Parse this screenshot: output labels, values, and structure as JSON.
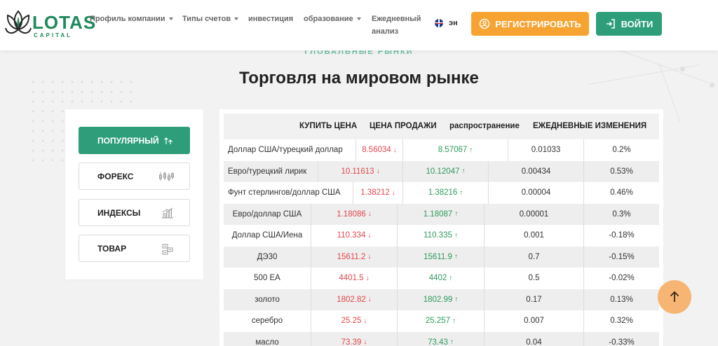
{
  "brand": {
    "name": "LOTAS",
    "sub": "CAPITAL"
  },
  "nav": [
    {
      "label": "Профиль компании",
      "dropdown": true
    },
    {
      "label": "Типы счетов",
      "dropdown": true
    },
    {
      "label": "инвестиция",
      "dropdown": false
    },
    {
      "label": "образование",
      "dropdown": true
    },
    {
      "label": "Ежедневный",
      "line2": "анализ",
      "dropdown": false
    }
  ],
  "language": "эн",
  "buttons": {
    "register": "РЕГИСТРИРОВАТЬ",
    "login": "ВОЙТИ"
  },
  "section": {
    "eyebrow": "ГЛОБАЛЬНЫЕ РЫНКИ",
    "title": "Торговля на мировом рынке"
  },
  "categories": [
    {
      "label": "ПОПУЛЯРНЫЙ",
      "active": true,
      "icon": "arrows-up-icon"
    },
    {
      "label": "ФОРЕКС",
      "active": false,
      "icon": "candles-icon"
    },
    {
      "label": "ИНДЕКСЫ",
      "active": false,
      "icon": "bar-chart-icon"
    },
    {
      "label": "ТОВАР",
      "active": false,
      "icon": "commodity-icon"
    }
  ],
  "table": {
    "headers": [
      "КУПИТЬ ЦЕНА",
      "ЦЕНА ПРОДАЖИ",
      "распространение",
      "ЕЖЕДНЕВНЫЕ ИЗМЕНЕНИЯ"
    ],
    "rows": [
      {
        "name": "Доллар США/турецкий доллар",
        "buy": "8.56034",
        "sell": "8.57067",
        "spread": "0.01033",
        "change": "0.2%"
      },
      {
        "name": "Евро/турецкий лирик",
        "buy": "10.11613",
        "sell": "10.12047",
        "spread": "0.00434",
        "change": "0.53%"
      },
      {
        "name": "Фунт стерлингов/доллар США",
        "buy": "1.38212",
        "sell": "1.38216",
        "spread": "0.00004",
        "change": "0.46%"
      },
      {
        "name": "Евро/доллар США",
        "buy": "1.18086",
        "sell": "1.18087",
        "spread": "0.00001",
        "change": "0.3%"
      },
      {
        "name": "Доллар США/Иена",
        "buy": "110.334",
        "sell": "110.335",
        "spread": "0.001",
        "change": "-0.18%"
      },
      {
        "name": "ДЭ30",
        "buy": "15611.2",
        "sell": "15611.9",
        "spread": "0.7",
        "change": "-0.15%"
      },
      {
        "name": "500 ЕА",
        "buy": "4401.5",
        "sell": "4402",
        "spread": "0.5",
        "change": "-0.02%"
      },
      {
        "name": "золото",
        "buy": "1802.82",
        "sell": "1802.99",
        "spread": "0.17",
        "change": "0.13%"
      },
      {
        "name": "серебро",
        "buy": "25.25",
        "sell": "25.257",
        "spread": "0.007",
        "change": "0.32%"
      },
      {
        "name": "масло",
        "buy": "73.39",
        "sell": "73.43",
        "spread": "0.04",
        "change": "-0.33%"
      }
    ]
  },
  "colors": {
    "green": "#2e9e7a",
    "orange": "#f7a332",
    "red": "#e0484e",
    "up": "#2f9a5b"
  }
}
